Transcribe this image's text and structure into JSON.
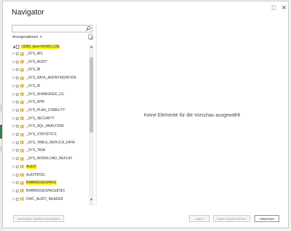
{
  "window": {
    "title": "Navigator",
    "restore_glyph": "□",
    "close_glyph": "✕"
  },
  "search": {
    "placeholder": "",
    "value": ""
  },
  "options": {
    "label": "Anzeigeoptionen",
    "chevron": "▾"
  },
  "tree": {
    "root": {
      "arrow": "◢",
      "label": "ODBC (dsn=DHWC) [35]"
    },
    "items": [
      {
        "label": "_SYS_AFL",
        "highlight": false
      },
      {
        "label": "_SYS_AUDIT",
        "highlight": false
      },
      {
        "label": "_SYS_BI",
        "highlight": false
      },
      {
        "label": "_SYS_DATA_ANONYMIZATION",
        "highlight": false
      },
      {
        "label": "_SYS_DI",
        "highlight": false
      },
      {
        "label": "_SYS_DI#BROKER_CG",
        "highlight": false
      },
      {
        "label": "_SYS_EPM",
        "highlight": false
      },
      {
        "label": "_SYS_PLAN_STABILITY",
        "highlight": false
      },
      {
        "label": "_SYS_SECURITY",
        "highlight": false
      },
      {
        "label": "_SYS_SQL_ANALYZER",
        "highlight": false
      },
      {
        "label": "_SYS_STATISTICS",
        "highlight": false
      },
      {
        "label": "_SYS_TABLE_REPLICA_DATA",
        "highlight": false
      },
      {
        "label": "_SYS_TASK",
        "highlight": false
      },
      {
        "label": "_SYS_WORKLOAD_REPLAY",
        "highlight": false
      },
      {
        "label": "AUDIT",
        "highlight": true
      },
      {
        "label": "AUDIT$TEC",
        "highlight": false
      },
      {
        "label": "BWBRIDGESPACE",
        "highlight": true
      },
      {
        "label": "BWBRIDGESPACE$TEC",
        "highlight": false
      },
      {
        "label": "DWC_AUDIT_READER",
        "highlight": false
      }
    ],
    "item_arrow": "▷"
  },
  "scrollbar": {
    "up": "▲",
    "down": "▼"
  },
  "preview": {
    "message": "Keine Elemente für die Vorschau ausgewählt"
  },
  "footer": {
    "select_related": "Verknüpfte Tabellen auswählen",
    "load": "Laden",
    "transform": "Daten transformieren",
    "cancel": "Abbrechen"
  },
  "colors": {
    "highlight": "#fcf50a",
    "folder": "#e7c56b"
  }
}
